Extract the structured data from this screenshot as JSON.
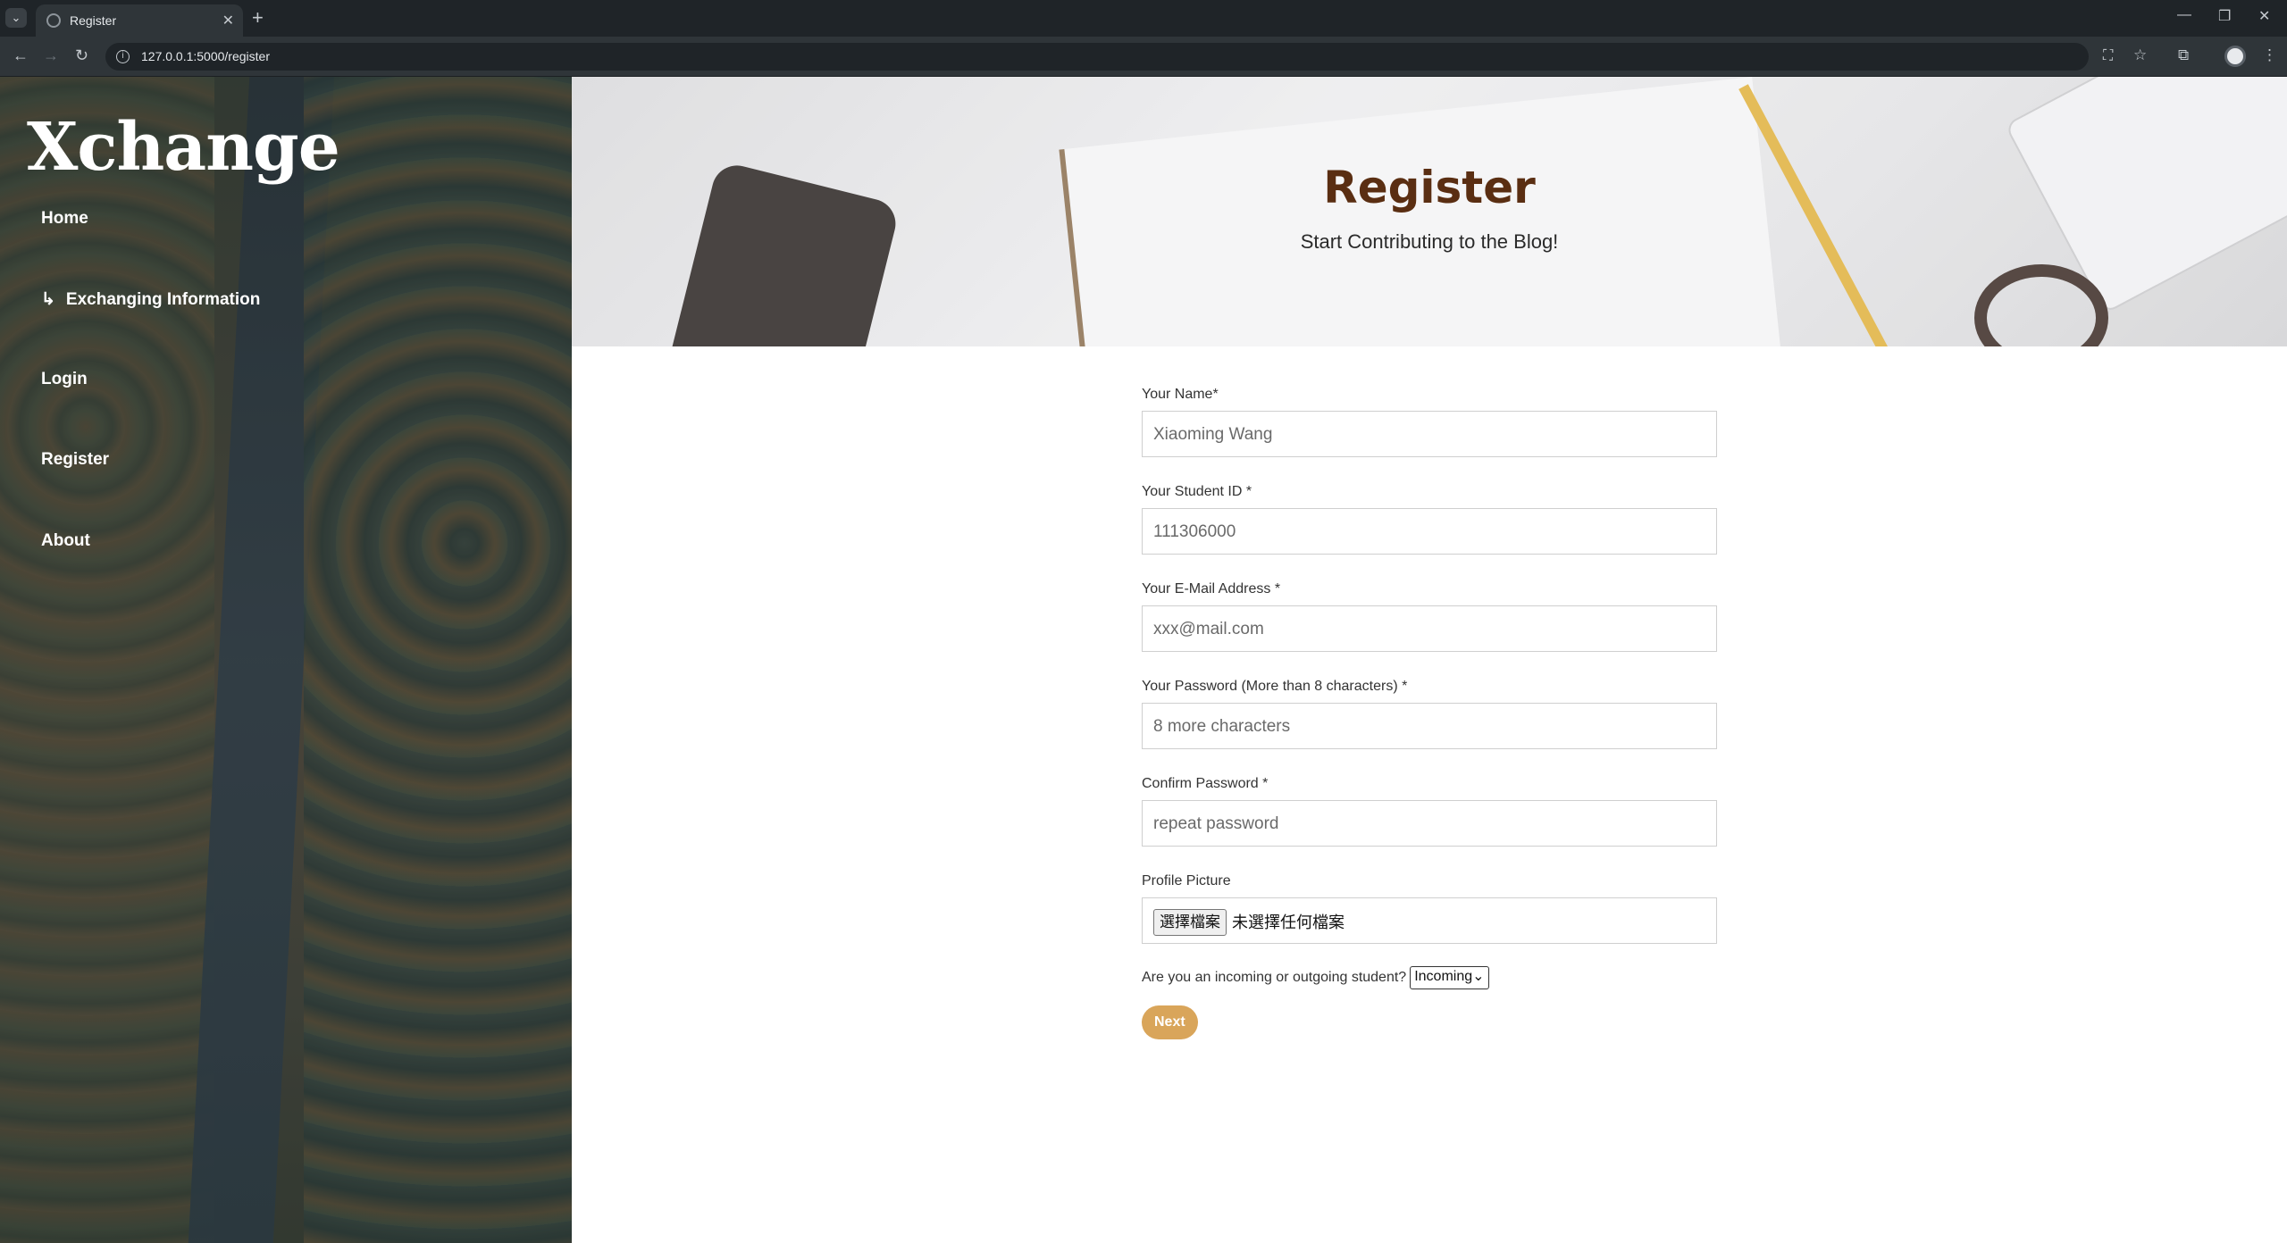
{
  "browser": {
    "tab_title": "Register",
    "url": "127.0.0.1:5000/register"
  },
  "sidebar": {
    "brand": "Xchange",
    "items": [
      {
        "label": "Home"
      },
      {
        "label": "Exchanging Information",
        "prefix": "↳"
      },
      {
        "label": "Login"
      },
      {
        "label": "Register"
      },
      {
        "label": "About"
      }
    ]
  },
  "hero": {
    "title": "Register",
    "subtitle": "Start Contributing to the Blog!"
  },
  "form": {
    "name": {
      "label": "Your Name*",
      "placeholder": "Xiaoming Wang"
    },
    "student_id": {
      "label": "Your Student ID *",
      "placeholder": "111306000"
    },
    "email": {
      "label": "Your E-Mail Address *",
      "placeholder": "xxx@mail.com"
    },
    "password": {
      "label": "Your Password (More than 8 characters) *",
      "placeholder": "8 more characters"
    },
    "confirm": {
      "label": "Confirm Password *",
      "placeholder": "repeat password"
    },
    "picture": {
      "label": "Profile Picture",
      "button": "選擇檔案",
      "status": "未選擇任何檔案"
    },
    "student_type": {
      "label": "Are you an incoming or outgoing student?",
      "selected": "Incoming"
    },
    "submit_label": "Next"
  },
  "colors": {
    "hero_title": "#5a2e12",
    "button": "#d9a55a"
  }
}
